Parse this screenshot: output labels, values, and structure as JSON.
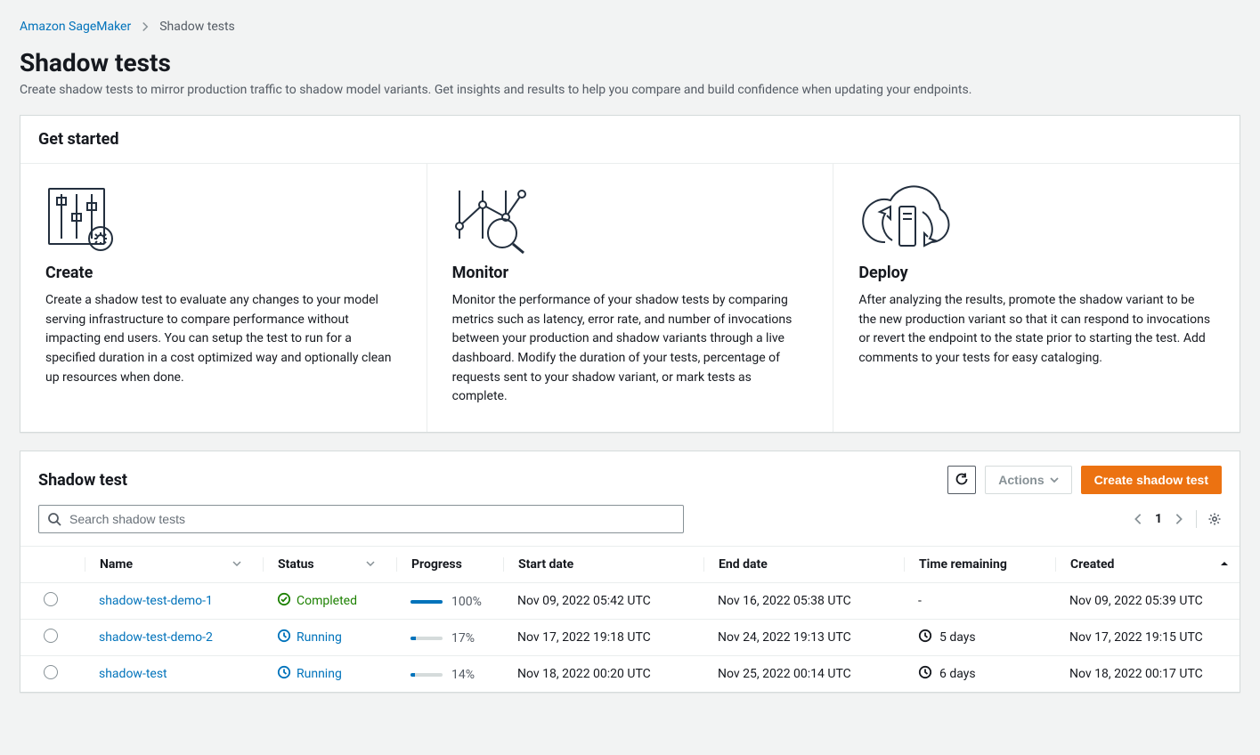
{
  "breadcrumb": {
    "root": "Amazon SageMaker",
    "current": "Shadow tests"
  },
  "page": {
    "title": "Shadow tests",
    "subtitle": "Create shadow tests to mirror production traffic to shadow model variants. Get insights and results to help you compare and build confidence when updating your endpoints."
  },
  "getStarted": {
    "heading": "Get started",
    "cards": [
      {
        "title": "Create",
        "body": "Create a shadow test to evaluate any changes to your model serving infrastructure to compare performance without impacting end users. You can setup the test to run for a specified duration in a cost optimized way and optionally clean up resources when done."
      },
      {
        "title": "Monitor",
        "body": "Monitor the performance of your shadow tests by comparing metrics such as latency, error rate, and number of invocations between your production and shadow variants through a live dashboard. Modify the duration of your tests, percentage of requests sent to your shadow variant, or mark tests as complete."
      },
      {
        "title": "Deploy",
        "body": "After analyzing the results, promote the shadow variant to be the new production variant so that it can respond to invocations or revert the endpoint to the state prior to starting the test. Add comments to your tests for easy cataloging."
      }
    ]
  },
  "listPanel": {
    "heading": "Shadow test",
    "actionsLabel": "Actions",
    "createLabel": "Create shadow test",
    "searchPlaceholder": "Search shadow tests",
    "pageNumber": "1"
  },
  "columns": {
    "name": "Name",
    "status": "Status",
    "progress": "Progress",
    "start": "Start date",
    "end": "End date",
    "remaining": "Time remaining",
    "created": "Created"
  },
  "rows": [
    {
      "name": "shadow-test-demo-1",
      "status": "Completed",
      "statusKind": "complete",
      "progressPct": "100%",
      "progressFill": "100%",
      "start": "Nov 09, 2022 05:42 UTC",
      "end": "Nov 16, 2022 05:38 UTC",
      "remaining": "-",
      "created": "Nov 09, 2022 05:39 UTC"
    },
    {
      "name": "shadow-test-demo-2",
      "status": "Running",
      "statusKind": "running",
      "progressPct": "17%",
      "progressFill": "17%",
      "start": "Nov 17, 2022 19:18 UTC",
      "end": "Nov 24, 2022 19:13 UTC",
      "remaining": "5 days",
      "created": "Nov 17, 2022 19:15 UTC"
    },
    {
      "name": "shadow-test",
      "status": "Running",
      "statusKind": "running",
      "progressPct": "14%",
      "progressFill": "14%",
      "start": "Nov 18, 2022 00:20 UTC",
      "end": "Nov 25, 2022 00:14 UTC",
      "remaining": "6 days",
      "created": "Nov 18, 2022 00:17 UTC"
    }
  ]
}
